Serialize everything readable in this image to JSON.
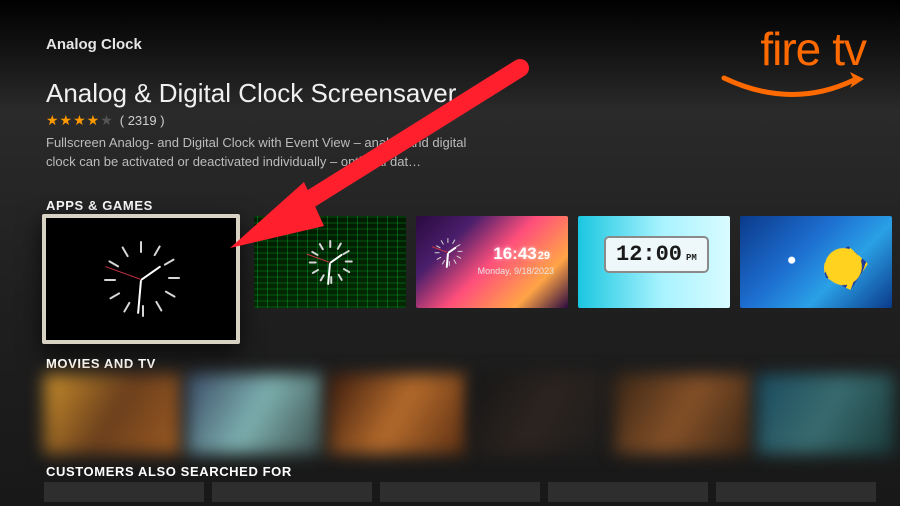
{
  "brand": {
    "name": "fire tv",
    "word_fire": "fire",
    "word_tv": "tv",
    "accent": "#ff6a00"
  },
  "breadcrumb": "Analog Clock",
  "app": {
    "title": "Analog & Digital Clock Screensaver",
    "rating_stars": 4,
    "rating_count": "( 2319 )",
    "description": "Fullscreen Analog- and Digital Clock with Event View – analog and digital clock can be activated or deactivated individually – optional dat…"
  },
  "sections": {
    "apps_label": "APPS & GAMES",
    "movies_label": "MOVIES AND TV",
    "customers_label": "CUSTOMERS ALSO SEARCHED FOR"
  },
  "apps_tiles": {
    "selected_name": "analog-clock-black",
    "jellyfish_time": "16:43",
    "jellyfish_seconds": "29",
    "jellyfish_date": "Monday, 9/18/2023",
    "lcd_hour": "12:",
    "lcd_min": "00",
    "lcd_ampm": "PM"
  },
  "annotation": {
    "arrow_color": "#ff1f2d"
  }
}
